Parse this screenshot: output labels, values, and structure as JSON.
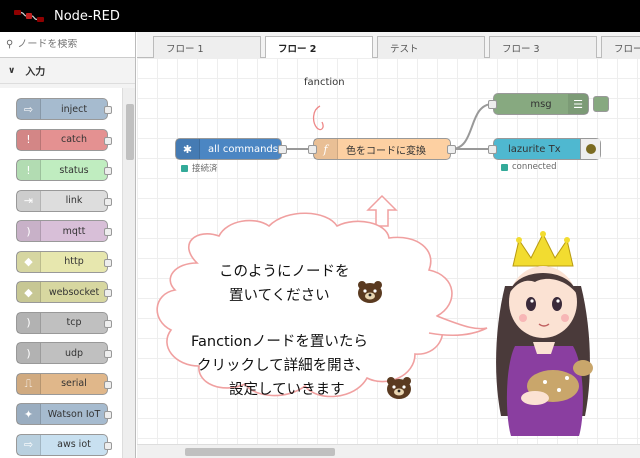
{
  "app": {
    "title": "Node-RED"
  },
  "search": {
    "placeholder": "ノードを検索"
  },
  "palette": {
    "category": "入力",
    "nodes": [
      {
        "label": "inject",
        "color": "#a6bbcf",
        "icon": "arrow-right-icon",
        "glyph": "⇨"
      },
      {
        "label": "catch",
        "color": "#e49191",
        "icon": "exclamation-icon",
        "glyph": "!"
      },
      {
        "label": "status",
        "color": "#c0edc0",
        "icon": "exclamation-icon",
        "glyph": "!"
      },
      {
        "label": "link",
        "color": "#dddddd",
        "icon": "link-icon",
        "glyph": "⇥"
      },
      {
        "label": "mqtt",
        "color": "#d8bfd8",
        "icon": "wave-icon",
        "glyph": ")"
      },
      {
        "label": "http",
        "color": "#e7e7ae",
        "icon": "globe-icon",
        "glyph": "◆"
      },
      {
        "label": "websocket",
        "color": "#d7d7a0",
        "icon": "globe-icon",
        "glyph": "◆"
      },
      {
        "label": "tcp",
        "color": "#c0c0c0",
        "icon": "wave-icon",
        "glyph": ")"
      },
      {
        "label": "udp",
        "color": "#c0c0c0",
        "icon": "wave-icon",
        "glyph": ")"
      },
      {
        "label": "serial",
        "color": "#e0b78a",
        "icon": "serial-icon",
        "glyph": "⎍"
      },
      {
        "label": "Watson IoT",
        "color": "#a6bbcf",
        "icon": "watson-icon",
        "glyph": "✦"
      },
      {
        "label": "aws iot",
        "color": "#c8e0f0",
        "icon": "arrow-right-icon",
        "glyph": "⇨"
      }
    ]
  },
  "tabs": [
    {
      "label": "フロー 1",
      "active": false
    },
    {
      "label": "フロー 2",
      "active": true
    },
    {
      "label": "テスト",
      "active": false
    },
    {
      "label": "フロー 3",
      "active": false
    },
    {
      "label": "フロー",
      "active": false
    }
  ],
  "flow": {
    "annotation": "fanction",
    "nodes": {
      "all_commands": {
        "label": "all commands",
        "status": "接続済",
        "color": "#4b86c3"
      },
      "function": {
        "label": "色をコードに変換",
        "color": "#fdd0a2",
        "glyph": "f"
      },
      "msg": {
        "label": "msg",
        "color": "#87a980"
      },
      "lazurite": {
        "label": "lazurite Tx",
        "status": "connected",
        "color": "#4fb8d0"
      }
    }
  },
  "bubble": {
    "line1": "このようにノードを",
    "line2": "置いてください",
    "line3": "Fanctionノードを置いたら",
    "line4": "クリックして詳細を開き、",
    "line5": "設定していきます"
  },
  "colors": {
    "arrow": "#f0a0a0",
    "header_bg": "#000000",
    "status_green": "#33aa99"
  }
}
